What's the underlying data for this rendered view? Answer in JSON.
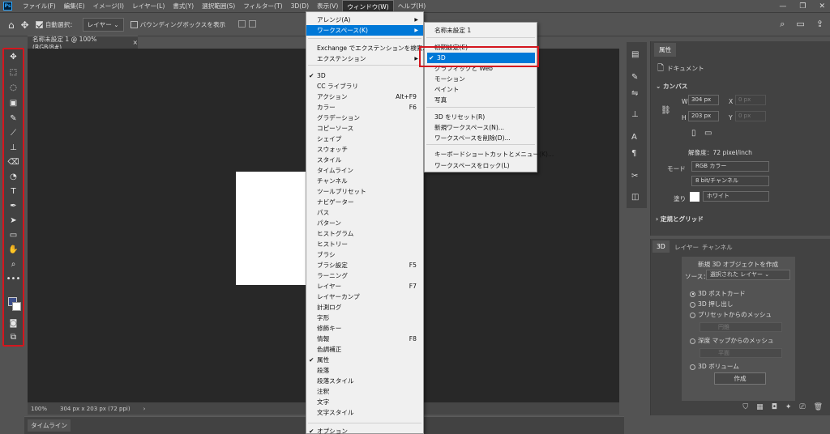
{
  "menubar": {
    "logo": "Ps",
    "items": [
      "ファイル(F)",
      "編集(E)",
      "イメージ(I)",
      "レイヤー(L)",
      "書式(Y)",
      "選択範囲(S)",
      "フィルター(T)",
      "3D(D)",
      "表示(V)",
      "ウィンドウ(W)",
      "ヘルプ(H)"
    ]
  },
  "optionsbar": {
    "auto_select_label": "自動選択：",
    "auto_select_value": "レイヤー",
    "bounding_box_label": "バウンディングボックスを表示"
  },
  "document": {
    "tab_title": "名称未設定 1 @ 100% (RGB/8#)",
    "close": "×",
    "zoom": "100%",
    "size_info": "304 px x 203 px (72 ppi)"
  },
  "timeline": {
    "tab": "タイムライン"
  },
  "window_menu": {
    "items": [
      {
        "label": "アレンジ(A)",
        "submenu": true
      },
      {
        "label": "ワークスペース(K)",
        "submenu": true,
        "highlighted": true
      },
      {
        "label": "Exchange でエクステンションを検索..."
      },
      {
        "label": "エクステンション",
        "submenu": true
      },
      {
        "label": "3D",
        "checked": true
      },
      {
        "label": "CC ライブラリ"
      },
      {
        "label": "アクション",
        "shortcut": "Alt+F9"
      },
      {
        "label": "カラー",
        "shortcut": "F6"
      },
      {
        "label": "グラデーション"
      },
      {
        "label": "コピーソース"
      },
      {
        "label": "シェイプ"
      },
      {
        "label": "スウォッチ"
      },
      {
        "label": "スタイル"
      },
      {
        "label": "タイムライン"
      },
      {
        "label": "チャンネル"
      },
      {
        "label": "ツールプリセット"
      },
      {
        "label": "ナビゲーター"
      },
      {
        "label": "パス"
      },
      {
        "label": "パターン"
      },
      {
        "label": "ヒストグラム"
      },
      {
        "label": "ヒストリー"
      },
      {
        "label": "ブラシ"
      },
      {
        "label": "ブラシ設定",
        "shortcut": "F5"
      },
      {
        "label": "ラーニング"
      },
      {
        "label": "レイヤー",
        "shortcut": "F7"
      },
      {
        "label": "レイヤーカンプ"
      },
      {
        "label": "計測ログ"
      },
      {
        "label": "字形"
      },
      {
        "label": "修飾キー"
      },
      {
        "label": "情報",
        "shortcut": "F8"
      },
      {
        "label": "色調補正"
      },
      {
        "label": "属性",
        "checked": true
      },
      {
        "label": "段落"
      },
      {
        "label": "段落スタイル"
      },
      {
        "label": "注釈"
      },
      {
        "label": "文字"
      },
      {
        "label": "文字スタイル"
      },
      {
        "label": "オプション",
        "checked": true
      }
    ]
  },
  "workspace_submenu": {
    "items": [
      {
        "label": "名称未設定 1"
      },
      {
        "label": "初期設定(E)"
      },
      {
        "label": "3D",
        "checked": true,
        "highlighted": true
      },
      {
        "label": "グラフィックと Web"
      },
      {
        "label": "モーション"
      },
      {
        "label": "ペイント"
      },
      {
        "label": "写真"
      },
      {
        "label": "3D をリセット(R)"
      },
      {
        "label": "新規ワークスペース(N)..."
      },
      {
        "label": "ワークスペースを削除(D)..."
      },
      {
        "label": "キーボードショートカットとメニュー(K)..."
      },
      {
        "label": "ワークスペースをロック(L)"
      }
    ]
  },
  "properties": {
    "tab": "属性",
    "doc_label": "ドキュメント",
    "canvas_header": "カンバス",
    "w_label": "W",
    "w_value": "304 px",
    "x_label": "X",
    "x_value": "0 px",
    "h_label": "H",
    "h_value": "203 px",
    "y_label": "Y",
    "y_value": "0 px",
    "resolution": "解像度：72 pixel/inch",
    "mode_label": "モード",
    "mode_value": "RGB カラー",
    "bits_value": "8 bit/チャンネル",
    "fill_label": "塗り",
    "fill_value": "ホワイト",
    "guides_header": "定規とグリッド"
  },
  "panel3d": {
    "tabs": [
      "3D",
      "レイヤー",
      "チャンネル"
    ],
    "new_object": "新規 3D オブジェクトを作成",
    "source_label": "ソース：",
    "source_value": "選択された レイヤー",
    "options": [
      "3D ポストカード",
      "3D 押し出し",
      "プリセットからのメッシュ",
      "深度 マップからのメッシュ",
      "3D ボリューム"
    ],
    "preset_value": "円錐",
    "depth_value": "平面",
    "create_button": "作成"
  },
  "colors": {
    "accent": "#0078d7",
    "highlight_box": "#d4161e",
    "foreground": "#3e4f8a",
    "background": "#ffffff"
  }
}
